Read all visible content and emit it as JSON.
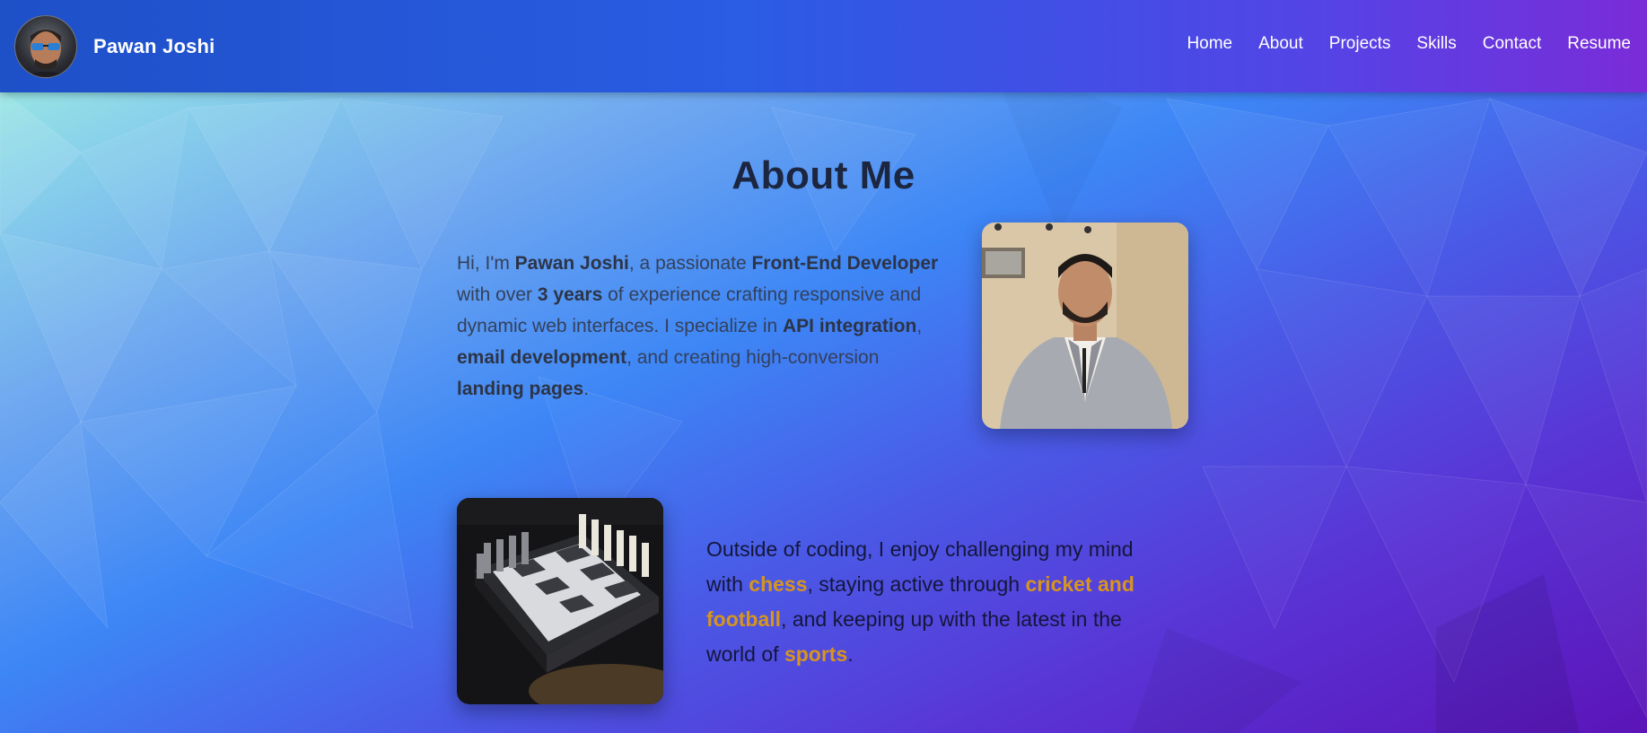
{
  "header": {
    "brand_name": "Pawan Joshi",
    "nav": [
      "Home",
      "About",
      "Projects",
      "Skills",
      "Contact",
      "Resume"
    ]
  },
  "about": {
    "title": "About Me",
    "intro": {
      "p1": "Hi, I'm ",
      "name": "Pawan Joshi",
      "p2": ", a passionate ",
      "role": "Front-End Developer",
      "p3": " with over ",
      "years": "3 years",
      "p4": " of experience crafting responsive and dynamic web interfaces. I specialize in ",
      "skill1": "API integration",
      "p5": ", ",
      "skill2": "email development",
      "p6": ", and creating high-conversion ",
      "skill3": "landing pages",
      "p7": "."
    },
    "hobbies": {
      "p1": "Outside of coding, I enjoy challenging my mind with ",
      "h1": "chess",
      "p2": ", staying active through ",
      "h2": "cricket and football",
      "p3": ", and keeping up with the latest in the world of ",
      "h3": "sports",
      "p4": "."
    }
  },
  "colors": {
    "navbar_start": "#1e50c8",
    "navbar_end": "#7a2cd8",
    "title": "#1c2640",
    "highlight": "#d6951e"
  }
}
